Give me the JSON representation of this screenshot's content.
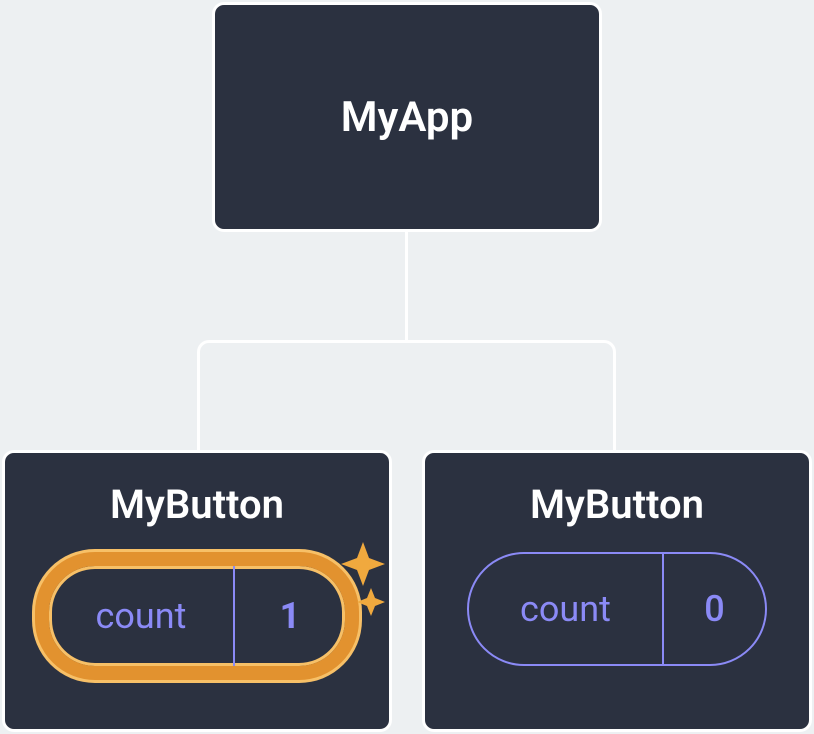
{
  "root": {
    "label": "MyApp"
  },
  "children": [
    {
      "label": "MyButton",
      "state": {
        "key": "count",
        "value": "1"
      },
      "highlighted": true
    },
    {
      "label": "MyButton",
      "state": {
        "key": "count",
        "value": "0"
      },
      "highlighted": false
    }
  ],
  "colors": {
    "node_bg": "#2b3140",
    "node_border": "#ffffff",
    "pill_border": "#8b8af6",
    "highlight_outer": "#f7c067",
    "highlight_inner": "#e2922f"
  }
}
